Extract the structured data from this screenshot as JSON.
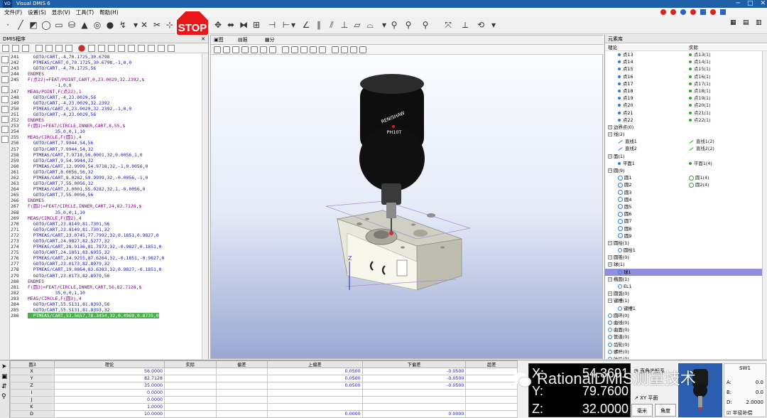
{
  "window": {
    "title": "Visual DMIS 6"
  },
  "menu": [
    "文件(F)",
    "设置(S)",
    "显示(V)",
    "工具(T)",
    "帮助(H)"
  ],
  "stop_label": "STOP",
  "program_panel": {
    "title": "DMIS程序"
  },
  "code_lines": [
    {
      "n": "241",
      "t": "  GOTO/CART,-4,70.1725,30.6798"
    },
    {
      "n": "242",
      "t": "  PTMEAS/CART,0,70.1725,30.6798,-1,0,0"
    },
    {
      "n": "243",
      "t": "  GOTO/CART,-4,70.1725,56"
    },
    {
      "n": "244",
      "t": "ENDMES"
    },
    {
      "n": "245",
      "t": "F(点22)=FEAT/POINT,CART,0,23.0029,32.2392,$"
    },
    {
      "n": "",
      "t": "          -1,0,0"
    },
    {
      "n": "247",
      "t": "MEAS/POINT,F(点22),1"
    },
    {
      "n": "248",
      "t": "  GOTO/CART,-4,23.0029,56"
    },
    {
      "n": "249",
      "t": "  GOTO/CART,-4,23.0029,32.2392"
    },
    {
      "n": "250",
      "t": "  PTMEAS/CART,0,23.0029,32.2392,-1,0,0"
    },
    {
      "n": "251",
      "t": "  GOTO/CART,-4,23.0029,56"
    },
    {
      "n": "252",
      "t": "ENDMES"
    },
    {
      "n": "253",
      "t": "F(圆1)=FEAT/CIRCLE,INNER,CART,8,55,$"
    },
    {
      "n": "254",
      "t": "          35,0,0,1,10"
    },
    {
      "n": "255",
      "t": "MEAS/CIRCLE,F(圆1),4"
    },
    {
      "n": "256",
      "t": "  GOTO/CART,7.9944,54,56"
    },
    {
      "n": "257",
      "t": "  GOTO/CART,7.9944,54,32"
    },
    {
      "n": "258",
      "t": "  PTMEAS/CART,7.9718,50.0001,32,0.0056,1,0"
    },
    {
      "n": "259",
      "t": "  GOTO/CART,9,54.9944,32"
    },
    {
      "n": "260",
      "t": "  PTMEAS/CART,12.9999,54.9718,32,-1,0.0056,0"
    },
    {
      "n": "261",
      "t": "  GOTO/CART,8.0056,56,32"
    },
    {
      "n": "262",
      "t": "  PTMEAS/CART,8.0282,59.9999,32,-0.0056,-1,0"
    },
    {
      "n": "263",
      "t": "  GOTO/CART,7,55.0056,32"
    },
    {
      "n": "264",
      "t": "  PTMEAS/CART,3.0001,55.0282,32,1,-0.0056,0"
    },
    {
      "n": "265",
      "t": "  GOTO/CART,7,55.0056,56"
    },
    {
      "n": "266",
      "t": "ENDMES"
    },
    {
      "n": "267",
      "t": "F(圆2)=FEAT/CIRCLE,INNER,CART,24,82.7128,$"
    },
    {
      "n": "268",
      "t": "          35,0,0,1,10"
    },
    {
      "n": "269",
      "t": "MEAS/CIRCLE,F(圆2),4"
    },
    {
      "n": "270",
      "t": "  GOTO/CART,23.8149,81.7301,56"
    },
    {
      "n": "271",
      "t": "  GOTO/CART,23.8149,81.7301,32"
    },
    {
      "n": "272",
      "t": "  PTMEAS/CART,23.0745,77.7992,32,0.1851,0.9827,0"
    },
    {
      "n": "273",
      "t": "  GOTO/CART,24.9827,82.5277,32"
    },
    {
      "n": "274",
      "t": "  PTMEAS/CART,28.9136,81.7873,32,-0.9827,0.1851,0"
    },
    {
      "n": "275",
      "t": "  GOTO/CART,24.1851,83.6955,32"
    },
    {
      "n": "276",
      "t": "  PTMEAS/CART,24.9255,87.6264,32,-0.1851,-0.9827,0"
    },
    {
      "n": "277",
      "t": "  GOTO/CART,23.0173,82.8979,32"
    },
    {
      "n": "278",
      "t": "  PTMEAS/CART,19.0864,83.6383,32,0.9827,-0.1851,0"
    },
    {
      "n": "279",
      "t": "  GOTO/CART,23.0173,82.8979,56"
    },
    {
      "n": "280",
      "t": "ENDMES"
    },
    {
      "n": "281",
      "t": "F(圆3)=FEAT/CIRCLE,INNER,CART,56,82.7128,$"
    },
    {
      "n": "282",
      "t": "          35,0,0,1,10"
    },
    {
      "n": "283",
      "t": "MEAS/CIRCLE,F(圆3),4"
    },
    {
      "n": "284",
      "t": "  GOTO/CART,55.5131,81.8393,56"
    },
    {
      "n": "285",
      "t": "  GOTO/CART,55.5131,81.8393,32"
    },
    {
      "n": "286",
      "t": "  PTMEAS/CART,53.5657,78.3454,32,0.4969,0.8735,0"
    }
  ],
  "viewport": {
    "tabs": [
      "图形",
      "报表",
      "分析"
    ],
    "probe_brand": "RENISHAW",
    "probe_model": "PH10T"
  },
  "feature_panel": {
    "title": "元素库",
    "col_nominal": "理论",
    "col_actual": "实际"
  },
  "tree": [
    {
      "type": "pt",
      "name": "点13",
      "act": "点13(1)"
    },
    {
      "type": "pt",
      "name": "点14",
      "act": "点14(1)"
    },
    {
      "type": "pt",
      "name": "点15",
      "act": "点15(1)"
    },
    {
      "type": "pt",
      "name": "点16",
      "act": "点16(1)"
    },
    {
      "type": "pt",
      "name": "点17",
      "act": "点17(1)"
    },
    {
      "type": "pt",
      "name": "点18",
      "act": "点18(1)"
    },
    {
      "type": "pt",
      "name": "点19",
      "act": "点19(1)"
    },
    {
      "type": "pt",
      "name": "点20",
      "act": "点20(1)"
    },
    {
      "type": "pt",
      "name": "点21",
      "act": "点21(1)"
    },
    {
      "type": "pt",
      "name": "点22",
      "act": "点22(1)"
    },
    {
      "type": "grp",
      "name": "边界点(0)",
      "act": ""
    },
    {
      "type": "grp",
      "name": "线(2)",
      "act": ""
    },
    {
      "type": "ln",
      "name": "直线1",
      "act": "直线1(2)"
    },
    {
      "type": "ln",
      "name": "直线2",
      "act": "直线2(2)"
    },
    {
      "type": "grp",
      "name": "面(1)",
      "act": ""
    },
    {
      "type": "pl",
      "name": "平面1",
      "act": "平面1(4)"
    },
    {
      "type": "grp",
      "name": "圆(9)",
      "act": ""
    },
    {
      "type": "ci",
      "name": "圆1",
      "act": "圆1(4)"
    },
    {
      "type": "ci",
      "name": "圆2",
      "act": "圆2(4)"
    },
    {
      "type": "ci",
      "name": "圆3",
      "act": ""
    },
    {
      "type": "ci",
      "name": "圆4",
      "act": ""
    },
    {
      "type": "ci",
      "name": "圆5",
      "act": ""
    },
    {
      "type": "ci",
      "name": "圆6",
      "act": ""
    },
    {
      "type": "ci",
      "name": "圆7",
      "act": ""
    },
    {
      "type": "ci",
      "name": "圆8",
      "act": ""
    },
    {
      "type": "ci",
      "name": "圆9",
      "act": ""
    },
    {
      "type": "grp",
      "name": "圆柱(1)",
      "act": ""
    },
    {
      "type": "cy",
      "name": "圆柱1",
      "act": ""
    },
    {
      "type": "grp",
      "name": "圆锥(0)",
      "act": ""
    },
    {
      "type": "grp",
      "name": "球(1)",
      "act": ""
    },
    {
      "type": "sel",
      "name": "球1",
      "act": ""
    },
    {
      "type": "grp",
      "name": "椭圆(1)",
      "act": ""
    },
    {
      "type": "el",
      "name": "EL1",
      "act": ""
    },
    {
      "type": "grp",
      "name": "圆弧(0)",
      "act": ""
    },
    {
      "type": "grp",
      "name": "键槽(1)",
      "act": ""
    },
    {
      "type": "sl",
      "name": "键槽1",
      "act": ""
    },
    {
      "type": "grp2",
      "name": "圆环(0)",
      "act": ""
    },
    {
      "type": "grp2",
      "name": "曲线(0)",
      "act": ""
    },
    {
      "type": "grp2",
      "name": "曲面(0)",
      "act": ""
    },
    {
      "type": "grp2",
      "name": "管道(0)",
      "act": ""
    },
    {
      "type": "grp2",
      "name": "齿轮(0)",
      "act": ""
    },
    {
      "type": "grp2",
      "name": "螺杆(0)",
      "act": ""
    },
    {
      "type": "grp2",
      "name": "叶片(0)",
      "act": ""
    }
  ],
  "results": {
    "feature": "圆3",
    "headers": [
      "理论",
      "实际",
      "偏差",
      "上偏差",
      "下偏差",
      "超差"
    ],
    "rows": [
      {
        "axis": "X",
        "nominal": "56.0000",
        "upper": "0.0500",
        "lower": "-0.0500"
      },
      {
        "axis": "Y",
        "nominal": "82.7128",
        "upper": "0.0500",
        "lower": "-0.0500"
      },
      {
        "axis": "Z",
        "nominal": "35.0000",
        "upper": "0.0500",
        "lower": "-0.0500"
      },
      {
        "axis": "I",
        "nominal": "0.0000",
        "upper": "",
        "lower": ""
      },
      {
        "axis": "J",
        "nominal": "0.0000",
        "upper": "",
        "lower": ""
      },
      {
        "axis": "K",
        "nominal": "1.0000",
        "upper": "",
        "lower": ""
      },
      {
        "axis": "D",
        "nominal": "10.0000",
        "upper": "0.0000",
        "lower": "0.0000"
      }
    ]
  },
  "dro": {
    "x_label": "X:",
    "x": "54.3691",
    "y_label": "Y:",
    "y": "79.7600",
    "z_label": "Z:",
    "z": "32.0000"
  },
  "coord": {
    "system": "直角坐标系",
    "mode": "XY 平面",
    "unit_btn": "毫米",
    "angle_btn": "角度"
  },
  "sw": {
    "title": "SW1",
    "a_label": "A:",
    "a": "0.0",
    "b_label": "B:",
    "b": "0.0",
    "d_label": "D:",
    "d": "2.0000",
    "comp_label": "半径补偿"
  },
  "watermark": "RationalDMIS测量技术"
}
